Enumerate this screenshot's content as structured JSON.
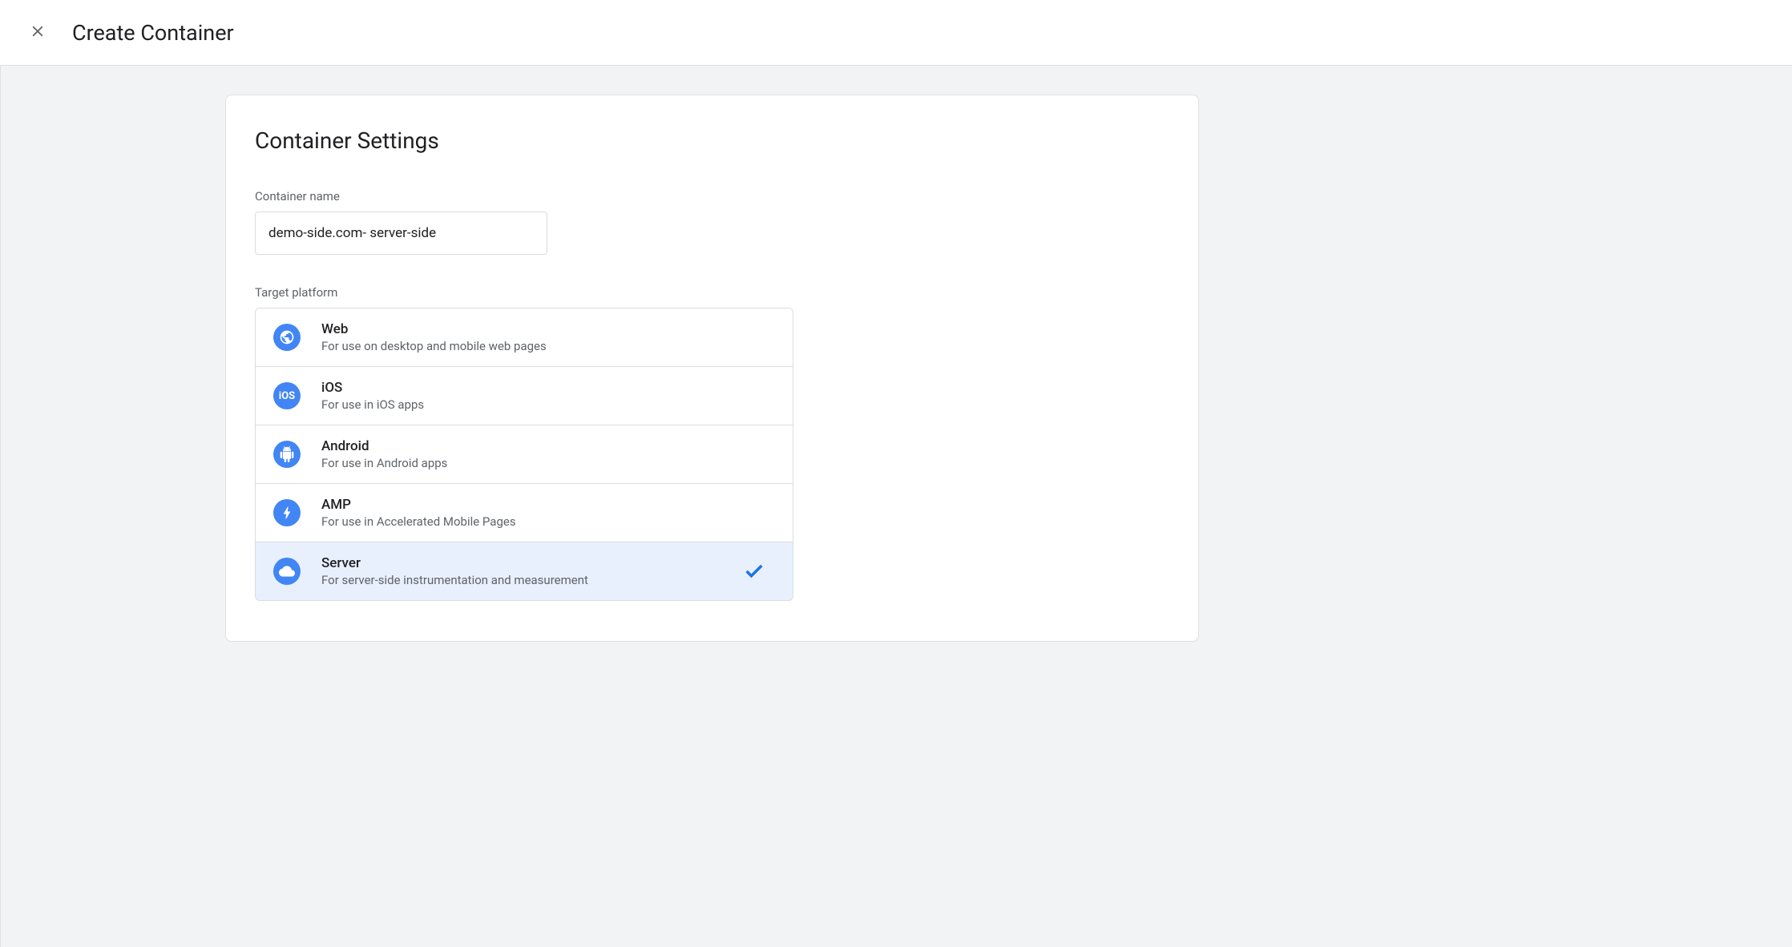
{
  "header": {
    "title": "Create Container"
  },
  "card": {
    "title": "Container Settings",
    "name_label": "Container name",
    "name_value": "demo-side.com- server-side",
    "platform_label": "Target platform"
  },
  "platforms": [
    {
      "name": "Web",
      "description": "For use on desktop and mobile web pages",
      "icon": "globe",
      "selected": false
    },
    {
      "name": "iOS",
      "description": "For use in iOS apps",
      "icon": "ios",
      "selected": false
    },
    {
      "name": "Android",
      "description": "For use in Android apps",
      "icon": "android",
      "selected": false
    },
    {
      "name": "AMP",
      "description": "For use in Accelerated Mobile Pages",
      "icon": "bolt",
      "selected": false
    },
    {
      "name": "Server",
      "description": "For server-side instrumentation and measurement",
      "icon": "cloud",
      "selected": true
    }
  ]
}
